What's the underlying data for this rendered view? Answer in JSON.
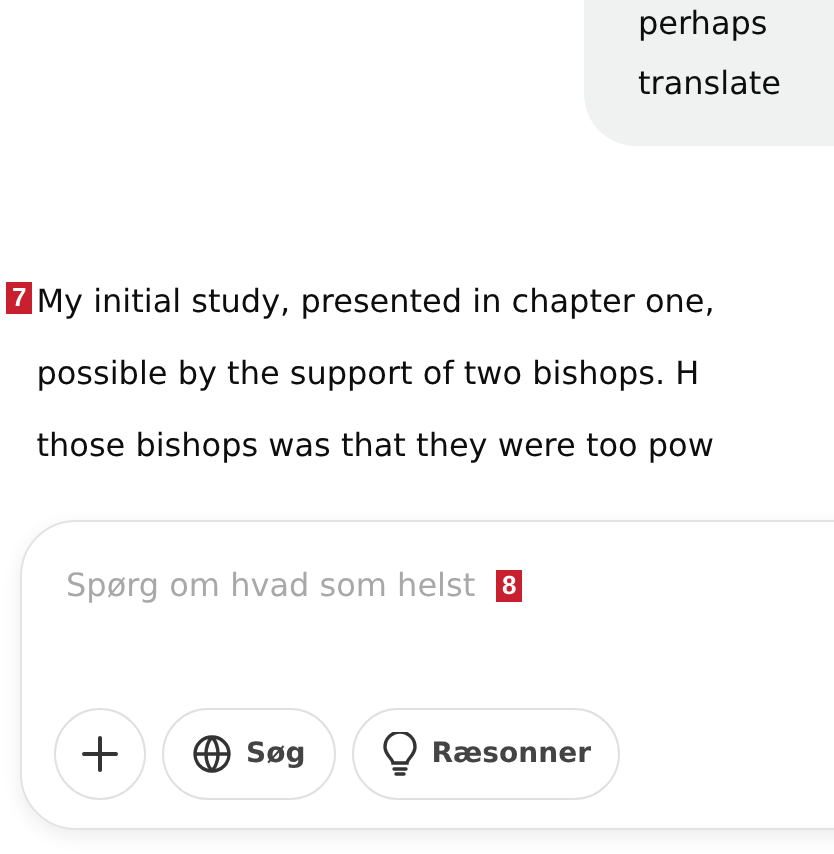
{
  "user_message": {
    "lines": [
      "perhaps",
      "translate"
    ]
  },
  "assistant_message": {
    "marker": "7",
    "lines": [
      "My initial study, presented in chapter one,",
      "possible by the support of two bishops. H",
      "those bishops was that they were too pow"
    ]
  },
  "composer": {
    "placeholder": "Spørg om hvad som helst",
    "marker": "8",
    "buttons": [
      {
        "kind": "add"
      },
      {
        "kind": "search",
        "label": "Søg"
      },
      {
        "kind": "reason",
        "label": "Ræsonner"
      }
    ]
  }
}
